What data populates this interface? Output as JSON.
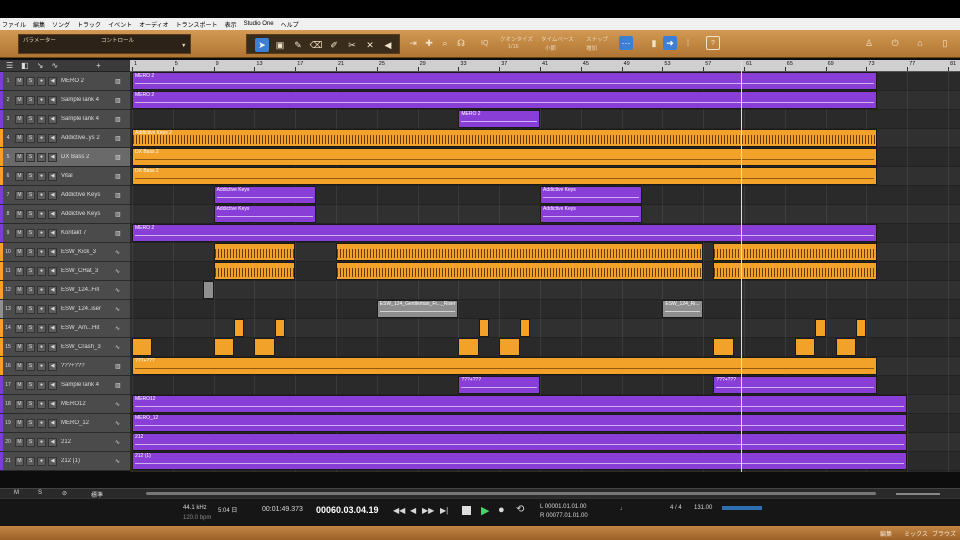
{
  "menu": [
    "ファイル",
    "編集",
    "ソング",
    "トラック",
    "イベント",
    "オーディオ",
    "トランスポート",
    "表示",
    "Studio One",
    "ヘルプ"
  ],
  "toolbar": {
    "param_label": "パラメーター",
    "control_label": "コントロール",
    "quantize_label": "クオンタイズ",
    "quantize_value": "1/16",
    "timebase_label": "タイムベース",
    "timebase_value": "小節",
    "snap_label": "スナップ",
    "snap_value": "増加",
    "iq_label": "IQ",
    "help_label": "?"
  },
  "ruler": {
    "marks": [
      "1",
      "5",
      "9",
      "13",
      "17",
      "21",
      "25",
      "29",
      "33",
      "37",
      "41",
      "45",
      "49",
      "53",
      "57",
      "61",
      "65",
      "69",
      "73",
      "77",
      "81"
    ]
  },
  "tracks": [
    {
      "num": "1",
      "name": "MERO 2",
      "type": "inst",
      "color": "#7a3fd0"
    },
    {
      "num": "2",
      "name": "SampleTank 4",
      "type": "inst",
      "color": "#7a3fd0"
    },
    {
      "num": "3",
      "name": "SampleTank 4",
      "type": "inst",
      "color": "#7a3fd0"
    },
    {
      "num": "4",
      "name": "Addictive..ys 2",
      "type": "inst",
      "color": "#f2a228"
    },
    {
      "num": "5",
      "name": "DX Bass 2",
      "type": "inst",
      "color": "#f2a228",
      "selected": true
    },
    {
      "num": "6",
      "name": "Vital",
      "type": "inst",
      "color": "#f2a228"
    },
    {
      "num": "7",
      "name": "Addictive Keys",
      "type": "inst",
      "color": "#7a3fd0"
    },
    {
      "num": "8",
      "name": "Addictive Keys",
      "type": "inst",
      "color": "#7a3fd0"
    },
    {
      "num": "9",
      "name": "Kontakt 7",
      "type": "inst",
      "color": "#7a3fd0"
    },
    {
      "num": "10",
      "name": "ESW_Kick_3",
      "type": "audio",
      "color": "#f2a228"
    },
    {
      "num": "11",
      "name": "ESW_CHat_3",
      "type": "audio",
      "color": "#f2a228"
    },
    {
      "num": "12",
      "name": "ESW_124..Fill",
      "type": "audio",
      "color": "#f2a228"
    },
    {
      "num": "13",
      "name": "ESW_124..iser",
      "type": "audio",
      "color": "#8f8f8f"
    },
    {
      "num": "14",
      "name": "ESW_Am...Hit",
      "type": "audio",
      "color": "#f2a228"
    },
    {
      "num": "15",
      "name": "ESW_Crash_3",
      "type": "audio",
      "color": "#f2a228"
    },
    {
      "num": "16",
      "name": "???+???",
      "type": "inst",
      "color": "#f2a228"
    },
    {
      "num": "17",
      "name": "SampleTank 4",
      "type": "inst",
      "color": "#7a3fd0"
    },
    {
      "num": "18",
      "name": "MERO12",
      "type": "audio",
      "color": "#7a3fd0"
    },
    {
      "num": "19",
      "name": "MERO_12",
      "type": "audio",
      "color": "#7a3fd0"
    },
    {
      "num": "20",
      "name": "212",
      "type": "audio",
      "color": "#7a3fd0"
    },
    {
      "num": "21",
      "name": "212 (1)",
      "type": "audio",
      "color": "#7a3fd0"
    }
  ],
  "events": {
    "mero2": "MERO 2",
    "addictive2": "Addictive Keys 2",
    "dxbass": "DX Bass 2",
    "vital": "DX Bass 2",
    "addkeys": "Addictive Keys",
    "gentleman": "ESW_124_Gentleman_Fr..._Riser",
    "esw_ri": "ESW_124_Ri...",
    "q": "???+???",
    "mero12": "MERO12",
    "mero_12": "MERO_12",
    "e212": "212",
    "e212_1": "212 (1)"
  },
  "transport": {
    "sample_rate": "44.1 kHz",
    "record_time": "5:04 日",
    "tempo_small": "120.0 bpm",
    "time": "00:01:49.373",
    "bars": "00060.03.04.19",
    "loop_start": "L 00001.01.01.00",
    "loop_end": "R 00077.01.01.00",
    "signature": "4 / 4",
    "bpm": "131.00"
  },
  "bottombar": {
    "edit": "編集",
    "mix": "ミックス",
    "browse": "ブラウズ",
    "m": "M",
    "s": "S",
    "standard": "標準"
  }
}
